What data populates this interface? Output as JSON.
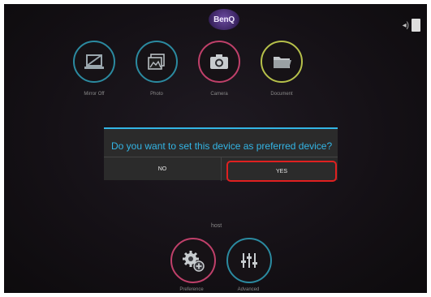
{
  "branding": {
    "logo_text": "BenQ"
  },
  "status": {
    "signal_icon": "signal-icon",
    "battery_icon": "battery-icon"
  },
  "apps": [
    {
      "label": "Mirror Off",
      "icon": "monitor-off-icon",
      "ring_color": "#2b8aa0"
    },
    {
      "label": "Photo",
      "icon": "photo-icon",
      "ring_color": "#2b8aa0"
    },
    {
      "label": "Camera",
      "icon": "camera-icon",
      "ring_color": "#c0406a"
    },
    {
      "label": "Document",
      "icon": "folder-icon",
      "ring_color": "#b6c04a"
    }
  ],
  "dialog": {
    "question": "Do you want to set this device as preferred device?",
    "no_label": "NO",
    "yes_label": "YES",
    "accent_color": "#33b5e5",
    "highlight_color": "#e02020"
  },
  "host_label": "host",
  "settings": [
    {
      "label": "Preference",
      "icon": "gear-plus-icon",
      "ring_color": "#c0406a"
    },
    {
      "label": "Advanced",
      "icon": "sliders-icon",
      "ring_color": "#2b8aa0"
    }
  ]
}
